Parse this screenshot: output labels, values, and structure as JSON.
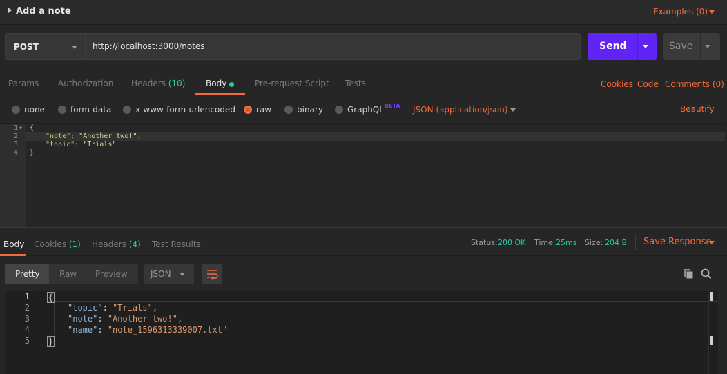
{
  "header": {
    "title": "Add a note",
    "examples_label": "Examples (0)"
  },
  "request": {
    "method": "POST",
    "url": "http://localhost:3000/notes",
    "send_label": "Send",
    "save_label": "Save"
  },
  "request_tabs": {
    "params": "Params",
    "authorization": "Authorization",
    "headers": "Headers",
    "headers_count": "(10)",
    "body": "Body",
    "prerequest": "Pre-request Script",
    "tests": "Tests",
    "cookies": "Cookies",
    "code": "Code",
    "comments": "Comments (0)"
  },
  "body_types": {
    "none": "none",
    "form_data": "form-data",
    "urlencoded": "x-www-form-urlencoded",
    "raw": "raw",
    "binary": "binary",
    "graphql": "GraphQL",
    "beta": "BETA",
    "selected": "raw",
    "content_type": "JSON (application/json)",
    "beautify": "Beautify"
  },
  "request_editor": {
    "line_numbers": [
      "1",
      "2",
      "3",
      "4"
    ],
    "line1": "{",
    "line2_key": "\"note\"",
    "line2_sep": ": ",
    "line2_val": "\"Another two!\"",
    "line2_end": ",",
    "line3_key": "\"topic\"",
    "line3_sep": ": ",
    "line3_val": "\"Trials\"",
    "line4": "}"
  },
  "response_tabs": {
    "body": "Body",
    "cookies": "Cookies",
    "cookies_count": "(1)",
    "headers": "Headers",
    "headers_count": "(4)",
    "test_results": "Test Results",
    "status_label": "Status:",
    "status_value": "200 OK",
    "time_label": "Time:",
    "time_value": "25ms",
    "size_label": "Size:",
    "size_value": "204 B",
    "save_response": "Save Response"
  },
  "response_toolbar": {
    "pretty": "Pretty",
    "raw": "Raw",
    "preview": "Preview",
    "format": "JSON"
  },
  "response_editor": {
    "line_numbers": [
      "1",
      "2",
      "3",
      "4",
      "5"
    ],
    "line1": "{",
    "line2_key": "\"topic\"",
    "line2_val": "\"Trials\"",
    "line3_key": "\"note\"",
    "line3_val": "\"Another two!\"",
    "line4_key": "\"name\"",
    "line4_val": "\"note_1596313339007.txt\"",
    "line5": "}",
    "sep": ": ",
    "comma": ","
  },
  "colors": {
    "accent": "#f26b3a",
    "send": "#6025f5",
    "success": "#27c8a1",
    "background": "#262626"
  },
  "icons": [
    "caret-right-icon",
    "chevron-down-icon",
    "wrap-lines-icon",
    "copy-icon",
    "search-icon"
  ]
}
